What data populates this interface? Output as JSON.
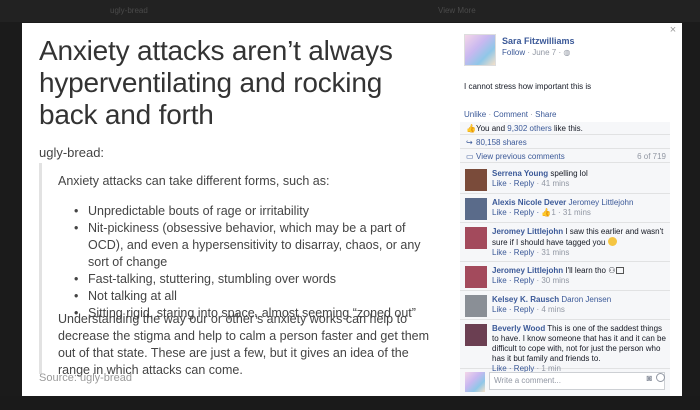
{
  "backdrop": {
    "top_left_text": "ugly-bread",
    "top_right_text": "View More"
  },
  "post": {
    "title": "Anxiety attacks aren’t always hyperventilating and rocking back and forth",
    "author": "ugly-bread:",
    "intro": "Anxiety attacks can take different forms, such as:",
    "bullets": [
      "Unpredictable bouts of rage or irritability",
      "Nit-pickiness (obsessive behavior, which may be a part of OCD), and even a hypersensitivity to disarray, chaos, or any sort of change",
      "Fast-talking, stuttering, stumbling over words",
      "Not talking at all",
      "Sitting rigid, staring into space, almost seeming “zoned out”"
    ],
    "outro": "Understanding the way our or other’s anxiety works can help to decrease the stigma and help to calm a person faster and get them out of that state. These are just a few, but it gives an idea of the range in which attacks can come.",
    "source": "Source: ugly-bread"
  },
  "close_label": "×",
  "fb": {
    "name": "Sara Fitzwilliams",
    "follow": "Follow",
    "date": " · June 7 · ",
    "status": "I cannot stress how important this is",
    "actions": {
      "unlike": "Unlike",
      "comment": "Comment",
      "share": "Share",
      "sep": " · "
    },
    "likes_prefix": "You and ",
    "likes_link": "9,302 others",
    "likes_suffix": " like this.",
    "shares": "80,158 shares",
    "view_previous": "View previous comments",
    "comment_count": "6 of 719",
    "comments": [
      {
        "author": "Serrena Young",
        "tag": "",
        "text": " spelling lol",
        "meta_reply": "Like · Reply",
        "meta_time": " · 41 mins",
        "avatar_color": "#7a4b3a"
      },
      {
        "author": "Alexis Nicole Dever",
        "tag": " Jeromey Littlejohn",
        "text": "",
        "meta_reply": "Like · Reply · ",
        "meta_time": "1 · 31 mins",
        "avatar_color": "#5a6b8a"
      },
      {
        "author": "Jeromey Littlejohn",
        "tag": "",
        "text": " I saw this earlier and wasn't sure if I should have tagged you ",
        "meta_reply": "Like · Reply",
        "meta_time": " · 31 mins",
        "avatar_color": "#a34a5c"
      },
      {
        "author": "Jeromey Littlejohn",
        "tag": "",
        "text": " I'll learn tho ",
        "meta_reply": "Like · Reply",
        "meta_time": " · 30 mins",
        "avatar_color": "#a34a5c"
      },
      {
        "author": "Kelsey K. Rausch",
        "tag": " Daron Jensen",
        "text": "",
        "meta_reply": "Like · Reply",
        "meta_time": " · 4 mins",
        "avatar_color": "#8a8f96"
      },
      {
        "author": "Beverly Wood",
        "tag": "",
        "text": " This is one of the saddest things to have. I know someone that has it and it can be difficult to cope with, not for just the person who has it but family and friends to.",
        "meta_reply": "Like · Reply",
        "meta_time": " · 1 min",
        "avatar_color": "#6b3f52"
      }
    ],
    "write_placeholder": "Write a comment..."
  }
}
